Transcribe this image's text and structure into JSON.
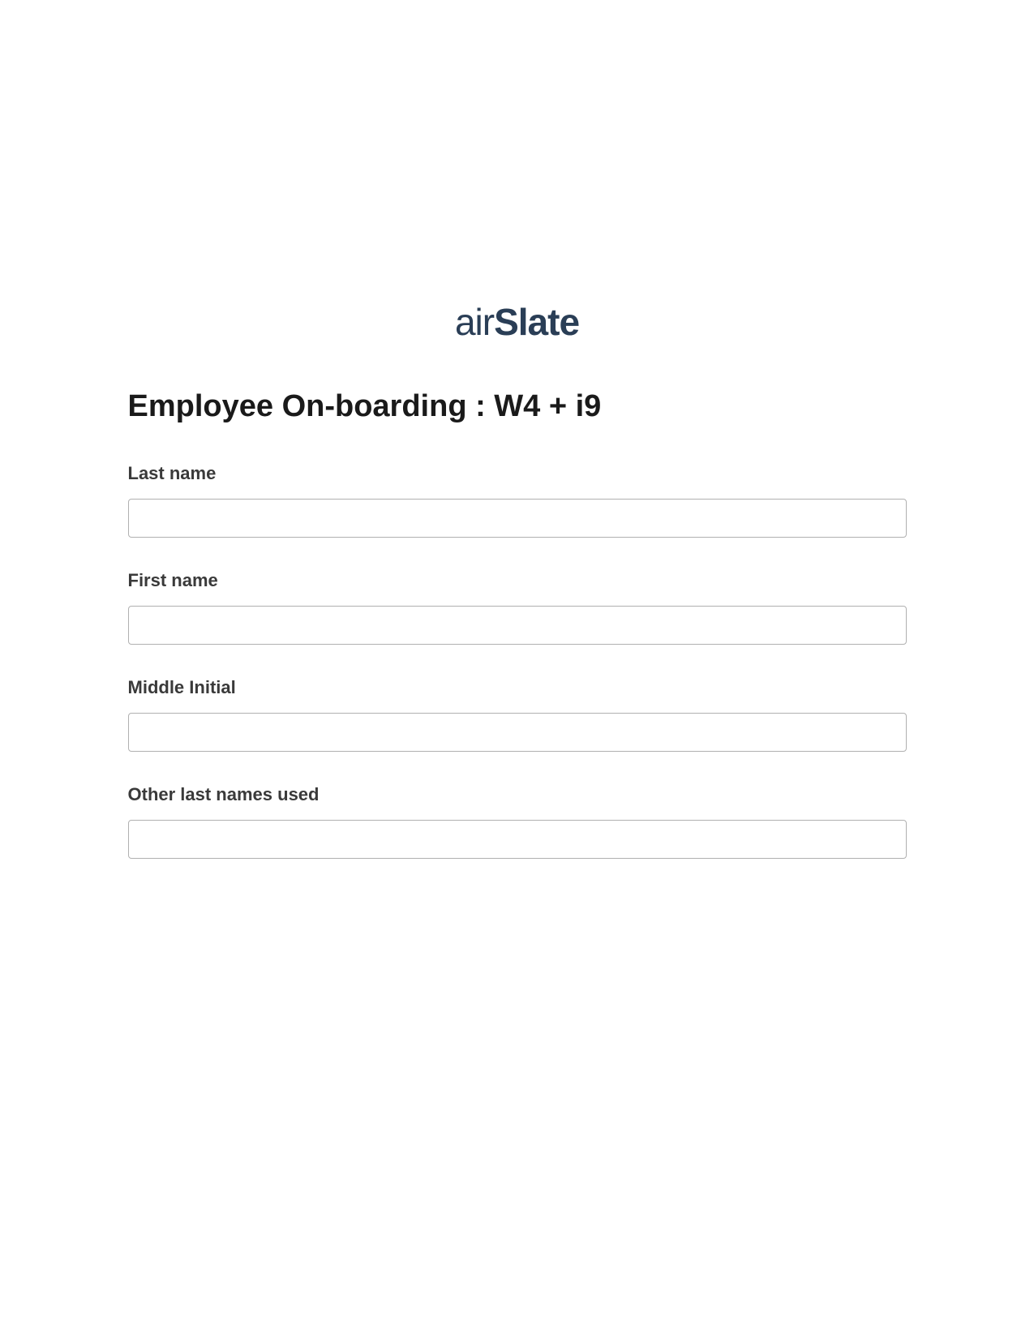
{
  "logo": {
    "text_air": "air",
    "text_slate": "Slate"
  },
  "title": "Employee On-boarding : W4 + i9",
  "fields": {
    "last_name": {
      "label": "Last name",
      "value": ""
    },
    "first_name": {
      "label": "First name",
      "value": ""
    },
    "middle_initial": {
      "label": "Middle Initial",
      "value": ""
    },
    "other_last_names": {
      "label": "Other last names used",
      "value": ""
    }
  }
}
